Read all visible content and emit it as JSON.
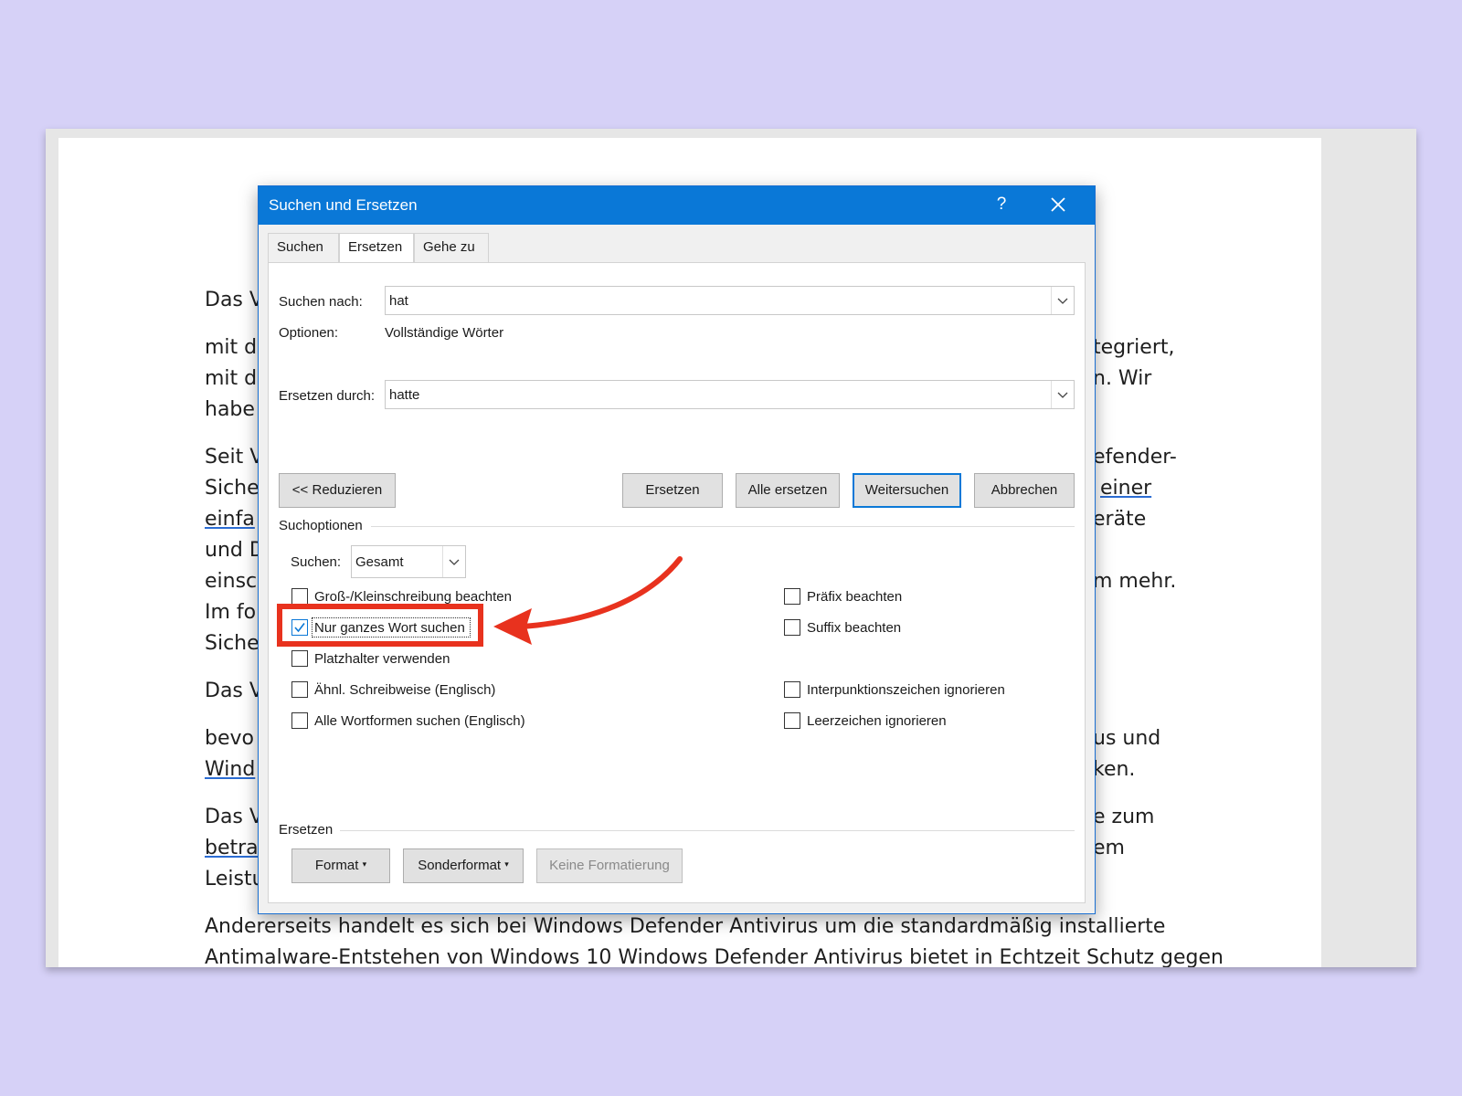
{
  "document": {
    "lines": [
      {
        "text": "Das V",
        "link": false
      },
      {
        "text": "mit d",
        "link": false
      },
      {
        "text": "mit d",
        "link": false
      },
      {
        "text": "habe",
        "link": false
      },
      {
        "text": "Seit V",
        "link": false
      },
      {
        "text": "Siche",
        "link": false
      },
      {
        "text": "einfa",
        "link": true
      },
      {
        "text": "und D",
        "link": false
      },
      {
        "text": "einsc",
        "link": false
      },
      {
        "text": "Im fo",
        "link": false
      },
      {
        "text": "Siche",
        "link": false
      },
      {
        "text": "Das V",
        "link": false
      },
      {
        "text": "bevo",
        "link": false
      },
      {
        "text": "Wind",
        "link": true
      },
      {
        "text": "Das V",
        "link": false
      },
      {
        "text": "betra",
        "link": true
      },
      {
        "text": "Leistu",
        "link": false
      }
    ],
    "right_fragments": [
      "tegriert,",
      "n. Wir",
      "efender-",
      "einer",
      "eräte",
      "m mehr.",
      "us und",
      "ken.",
      "e zum",
      "em"
    ],
    "full_line_1": "Andererseits handelt es sich bei Windows Defender Antivirus um die standardmäßig installierte",
    "full_line_2": "Antimalware-Entstehen von Windows 10 Windows Defender Antivirus bietet in Echtzeit Schutz gegen"
  },
  "dialog": {
    "title": "Suchen und Ersetzen",
    "help_symbol": "?",
    "tabs": [
      "Suchen",
      "Ersetzen",
      "Gehe zu"
    ],
    "active_tab": "Ersetzen",
    "find_label": "Suchen nach:",
    "find_value": "hat",
    "options_label": "Optionen:",
    "options_value": "Vollständige Wörter",
    "replace_label": "Ersetzen durch:",
    "replace_value": "hatte",
    "buttons": {
      "reduce": "<< Reduzieren",
      "replace": "Ersetzen",
      "replace_all": "Alle ersetzen",
      "find_next": "Weitersuchen",
      "cancel": "Abbrechen"
    },
    "search_options_heading": "Suchoptionen",
    "search_direction_label": "Suchen:",
    "search_direction_value": "Gesamt",
    "checkboxes_left": [
      {
        "label": "Groß-/Kleinschreibung beachten",
        "checked": false
      },
      {
        "label": "Nur ganzes Wort suchen",
        "checked": true
      },
      {
        "label": "Platzhalter verwenden",
        "checked": false
      },
      {
        "label": "Ähnl. Schreibweise (Englisch)",
        "checked": false
      },
      {
        "label": "Alle Wortformen suchen (Englisch)",
        "checked": false
      }
    ],
    "checkboxes_right": [
      {
        "label": "Präfix beachten",
        "checked": false
      },
      {
        "label": "Suffix beachten",
        "checked": false
      },
      {
        "label": "Interpunktionszeichen ignorieren",
        "checked": false
      },
      {
        "label": "Leerzeichen ignorieren",
        "checked": false
      }
    ],
    "replace_heading": "Ersetzen",
    "format_buttons": {
      "format": "Format",
      "special": "Sonderformat",
      "no_formatting": "Keine Formatierung"
    }
  },
  "colors": {
    "titlebar": "#0a78d7",
    "highlight": "#e8321e",
    "background": "#d6d1f7"
  }
}
